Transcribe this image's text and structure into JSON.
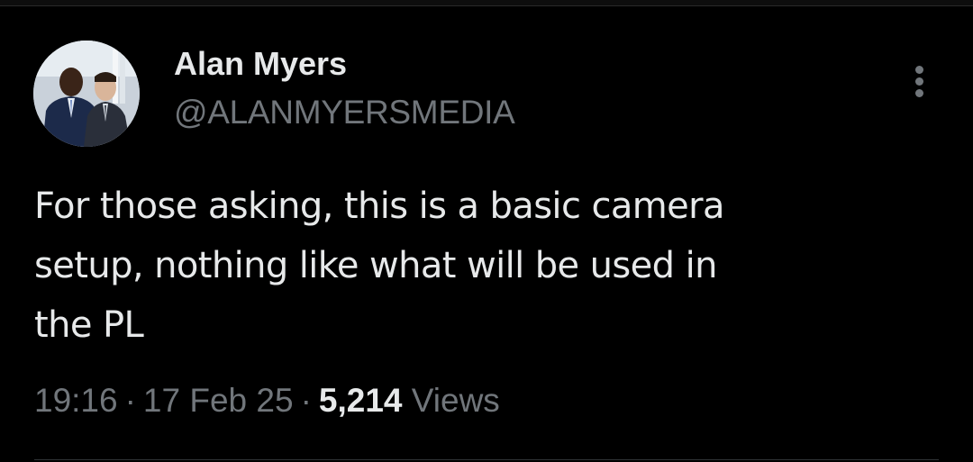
{
  "tweet": {
    "author": {
      "name": "Alan Myers",
      "handle": "@ALANMYERSMEDIA",
      "avatar_icon": "profile-photo"
    },
    "more_icon": "more-options-vertical-icon",
    "text_lines": [
      "For those asking, this is a basic camera",
      "setup, nothing like what will be used in",
      "the PL"
    ],
    "meta": {
      "time": "19:16",
      "separator": "·",
      "date": "17 Feb 25",
      "views_count": "5,214",
      "views_label": "Views"
    }
  },
  "colors": {
    "background": "#000000",
    "primary_text": "#e7e9ea",
    "secondary_text": "#71767b",
    "divider": "#2f3336"
  }
}
